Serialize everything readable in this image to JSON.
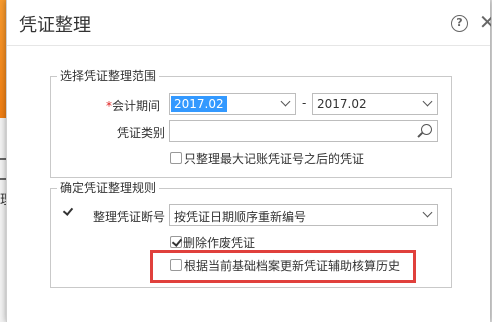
{
  "background": {
    "side_text": "理"
  },
  "dialog": {
    "title": "凭证整理",
    "help_glyph": "?",
    "close_glyph": "✕"
  },
  "range_group": {
    "legend": "选择凭证整理范围",
    "period_required_mark": "*",
    "period_label": "会计期间",
    "period_from": "2017.02",
    "period_separator": "-",
    "period_to": "2017.02",
    "voucher_type_label": "凭证类别",
    "voucher_type_value": "",
    "only_after_max_label": "只整理最大记账凭证号之后的凭证",
    "only_after_max_checked": false
  },
  "rules_group": {
    "legend": "确定凭证整理规则",
    "break_enabled": true,
    "break_label": "整理凭证断号",
    "break_rule_value": "按凭证日期顺序重新编号",
    "delete_void_label": "删除作废凭证",
    "delete_void_checked": true,
    "update_aux_label": "根据当前基础档案更新凭证辅助核算历史",
    "update_aux_checked": false
  },
  "colors": {
    "highlight_border": "#e0403c",
    "selection_bg": "#3399ff",
    "required_mark": "#e02020",
    "accent_orange": "#ee7d12"
  },
  "icons": [
    "help-icon",
    "close-icon",
    "chevron-down-icon",
    "search-icon",
    "checkbox-icon"
  ]
}
